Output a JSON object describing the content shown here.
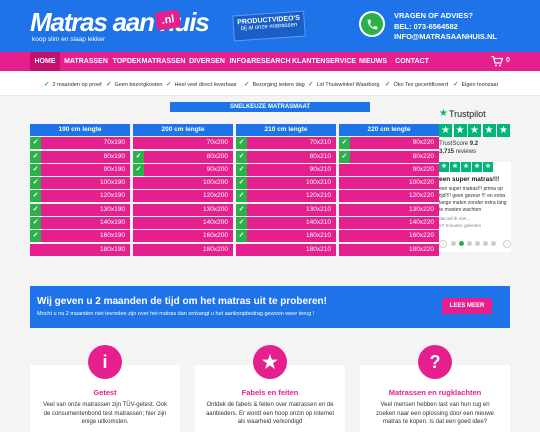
{
  "header": {
    "logo_text": "Matras aan huis",
    "logo_badge": ".nl",
    "logo_tagline": "koop slim en slaap lekker",
    "video_title": "PRODUCTVIDEO'S",
    "video_sub": "bij al onze matrassen",
    "contact_question": "VRAGEN OF ADVIES?",
    "contact_phone": "BEL: 073-6564582",
    "contact_email": "INFO@MATRASAANHUIS.NL"
  },
  "nav": {
    "items": [
      "HOME",
      "MATRASSEN",
      "TOPDEKMATRASSEN",
      "DIVERSEN",
      "INFO&RESEARCH",
      "KLANTENSERVICE",
      "NIEUWS",
      "CONTACT"
    ],
    "cart_count": "0"
  },
  "usp": [
    "2 maanden op proef",
    "Geen bezorgkosten",
    "Heel veel direct leverbaar",
    "Bezorging iedere dag",
    "Lid Thuiswinkel Waarborg",
    "Öko Tex gecertificeerd",
    "Eigen toonzaal"
  ],
  "quick_select": {
    "title": "SNELKEUZE MATRASMAAT",
    "columns": [
      {
        "heading": "190 cm lengte",
        "sizes": [
          "70x190",
          "80x190",
          "90x190",
          "100x190",
          "120x190",
          "130x190",
          "140x190",
          "160x190",
          "180x190"
        ],
        "checked": [
          true,
          true,
          true,
          true,
          true,
          true,
          true,
          true,
          false
        ]
      },
      {
        "heading": "200 cm lengte",
        "sizes": [
          "70x200",
          "80x200",
          "90x200",
          "100x200",
          "120x200",
          "130x200",
          "140x200",
          "160x200",
          "180x200"
        ],
        "checked": [
          false,
          true,
          true,
          false,
          false,
          false,
          false,
          false,
          false
        ]
      },
      {
        "heading": "210 cm lengte",
        "sizes": [
          "70x210",
          "80x210",
          "90x210",
          "100x210",
          "120x210",
          "130x210",
          "140x210",
          "160x210",
          "180x210"
        ],
        "checked": [
          true,
          true,
          true,
          true,
          true,
          true,
          true,
          true,
          false
        ]
      },
      {
        "heading": "220 cm lengte",
        "sizes": [
          "90x220",
          "80x220",
          "90x220",
          "100x220",
          "120x220",
          "130x220",
          "140x220",
          "160x220",
          "180x220"
        ],
        "checked": [
          true,
          true,
          false,
          false,
          false,
          false,
          false,
          false,
          false
        ]
      }
    ]
  },
  "trustpilot": {
    "brand": "Trustpilot",
    "rating_stars": 5,
    "score_label": "TrustScore",
    "score": "9.2",
    "reviews_count": "3,715",
    "reviews_label": "reviews",
    "review": {
      "stars": 5,
      "title": "een super matras!!!",
      "body": "een super matras!!! prima op tijd!!!! geen gezeur !!! en extra lange maten zonder extra lang te moeten wachten",
      "author": "dat wil ik niet...",
      "time": "67 minuten geleden"
    },
    "dots_total": 6,
    "dots_active": 1
  },
  "promo": {
    "title": "Wij geven u 2 maanden de tijd om het matras uit te proberen!",
    "subtitle": "Mocht u na 2 maanden niet tevreden zijn over het matras dan ontvangt u het aankoopbedrag gewoon weer terug !",
    "button": "LEES MEER"
  },
  "cards": [
    {
      "icon": "info-icon",
      "title": "Getest",
      "text": "Veel van onze matrassen zijn TÜV-getest. Ook de consumentenbond test matrassen; hier zijn enige uitkomsten."
    },
    {
      "icon": "star-icon",
      "title": "Fabels en feiten",
      "text": "Ontdek de fabels & feiten over matrassen en de aanbieders. Er wordt een hoop onzin op internet als waarheid verkondigd"
    },
    {
      "icon": "question-icon",
      "title": "Matrassen en rugklachten",
      "text": "Veel mensen hebben last van hun rug en zoeken naar een oplossing door een nieuwe matras te kopen. Is dat een goed idee?"
    }
  ],
  "colors": {
    "blue": "#1e73e8",
    "pink": "#e5208e",
    "green": "#2bb04a",
    "trustpilot_green": "#00b67a"
  }
}
